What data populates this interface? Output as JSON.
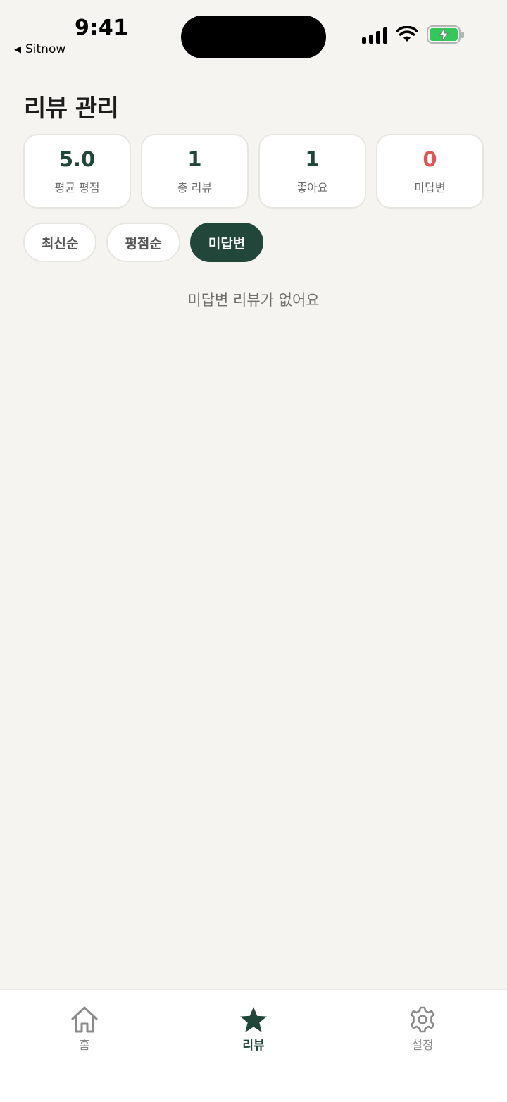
{
  "status_bar": {
    "time": "9:41",
    "back_app": "Sitnow",
    "back_icon": "back-triangle-icon",
    "battery_color": "#34c759"
  },
  "page": {
    "title": "리뷰 관리"
  },
  "stats": [
    {
      "value": "5.0",
      "label": "평균 평점"
    },
    {
      "value": "1",
      "label": "총 리뷰"
    },
    {
      "value": "1",
      "label": "좋아요"
    },
    {
      "value": "0",
      "label": "미답변",
      "color": "#e05656"
    }
  ],
  "filters": [
    {
      "label": "최신순",
      "active": false
    },
    {
      "label": "평점순",
      "active": false
    },
    {
      "label": "미답변",
      "active": true
    }
  ],
  "empty_message": "미답변 리뷰가 없어요",
  "tabbar": {
    "items": [
      {
        "label": "홈",
        "icon": "home-icon",
        "active": false
      },
      {
        "label": "리뷰",
        "icon": "star-icon",
        "active": true
      },
      {
        "label": "설정",
        "icon": "gear-icon",
        "active": false
      }
    ]
  },
  "colors": {
    "accent": "#21473a",
    "background": "#f5f4f0",
    "alert": "#e05656"
  }
}
